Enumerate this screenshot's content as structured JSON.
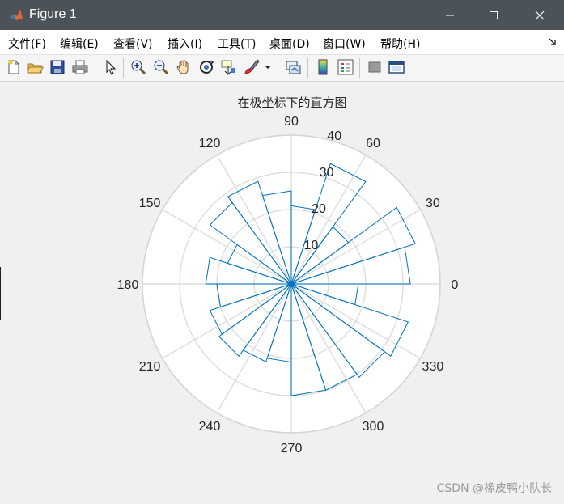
{
  "window": {
    "title": "Figure 1"
  },
  "menu": {
    "items": [
      "文件(F)",
      "编辑(E)",
      "查看(V)",
      "插入(I)",
      "工具(T)",
      "桌面(D)",
      "窗口(W)",
      "帮助(H)"
    ]
  },
  "toolbar": {
    "icons": [
      "new-figure-icon",
      "open-file-icon",
      "save-icon",
      "print-icon",
      "select-arrow-icon",
      "zoom-in-icon",
      "zoom-out-icon",
      "pan-hand-icon",
      "rotate-3d-icon",
      "data-cursor-icon",
      "brush-icon",
      "link-plot-icon",
      "colorbar-icon",
      "legend-icon",
      "hide-plot-tools-icon",
      "show-plot-tools-icon"
    ]
  },
  "chart_data": {
    "type": "polar-histogram",
    "title": "在极坐标下的直方图",
    "theta_ticks_deg": [
      0,
      30,
      60,
      90,
      120,
      150,
      180,
      210,
      240,
      270,
      300,
      330
    ],
    "theta_tick_labels": [
      "0",
      "30",
      "60",
      "90",
      "120",
      "150",
      "180",
      "210",
      "240",
      "270",
      "300",
      "330"
    ],
    "r_ticks": [
      10,
      20,
      30,
      40
    ],
    "r_tick_labels": [
      "10",
      "20",
      "30",
      "40"
    ],
    "rlim": [
      0,
      40
    ],
    "bin_width_deg": 18,
    "bin_edges_deg": [
      0,
      18,
      36,
      54,
      72,
      90,
      108,
      126,
      144,
      162,
      180,
      198,
      216,
      234,
      252,
      270,
      288,
      306,
      324,
      342,
      360
    ],
    "counts": [
      32,
      35,
      19,
      34,
      21,
      25,
      29,
      27,
      18,
      23,
      20,
      23,
      24,
      22,
      21,
      30,
      30,
      31,
      33,
      18
    ],
    "grid": true,
    "series_color": "#0072bd",
    "grid_color": "#dddddd"
  },
  "watermark": "CSDN @橡皮鸭小队长"
}
